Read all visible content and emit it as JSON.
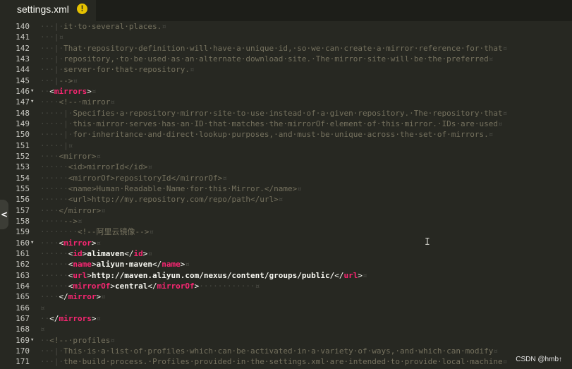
{
  "tab": {
    "title": "settings.xml",
    "badge": "!"
  },
  "watermark": "CSDN @hmb↑",
  "lines": [
    {
      "n": "140",
      "fold": "",
      "segs": [
        [
          "ws",
          "···|·"
        ],
        [
          "comment",
          "it·to·several·places."
        ],
        [
          "ws",
          "¤"
        ]
      ]
    },
    {
      "n": "141",
      "fold": "",
      "segs": [
        [
          "ws",
          "···|¤"
        ]
      ]
    },
    {
      "n": "142",
      "fold": "",
      "segs": [
        [
          "ws",
          "···|·"
        ],
        [
          "comment",
          "That·repository·definition·will·have·a·unique·id,·so·we·can·create·a·mirror·reference·for·that"
        ],
        [
          "ws",
          "¤"
        ]
      ]
    },
    {
      "n": "143",
      "fold": "",
      "segs": [
        [
          "ws",
          "···|·"
        ],
        [
          "comment",
          "repository,·to·be·used·as·an·alternate·download·site.·The·mirror·site·will·be·the·preferred"
        ],
        [
          "ws",
          "¤"
        ]
      ]
    },
    {
      "n": "144",
      "fold": "",
      "segs": [
        [
          "ws",
          "···|·"
        ],
        [
          "comment",
          "server·for·that·repository."
        ],
        [
          "ws",
          "¤"
        ]
      ]
    },
    {
      "n": "145",
      "fold": "",
      "segs": [
        [
          "ws",
          "···|"
        ],
        [
          "comment",
          "-->"
        ],
        [
          "ws",
          "¤"
        ]
      ]
    },
    {
      "n": "146",
      "fold": "▾",
      "segs": [
        [
          "ws",
          "··"
        ],
        [
          "text",
          "<"
        ],
        [
          "tagb",
          "mirrors"
        ],
        [
          "text",
          ">"
        ],
        [
          "ws",
          "¤"
        ]
      ]
    },
    {
      "n": "147",
      "fold": "▾",
      "segs": [
        [
          "ws",
          "····"
        ],
        [
          "comment",
          "<!--·mirror"
        ],
        [
          "ws",
          "¤"
        ]
      ]
    },
    {
      "n": "148",
      "fold": "",
      "segs": [
        [
          "ws",
          "·····|·"
        ],
        [
          "comment",
          "Specifies·a·repository·mirror·site·to·use·instead·of·a·given·repository.·The·repository·that"
        ],
        [
          "ws",
          "¤"
        ]
      ]
    },
    {
      "n": "149",
      "fold": "",
      "segs": [
        [
          "ws",
          "·····|·"
        ],
        [
          "comment",
          "this·mirror·serves·has·an·ID·that·matches·the·mirrorOf·element·of·this·mirror.·IDs·are·used"
        ],
        [
          "ws",
          "¤"
        ]
      ]
    },
    {
      "n": "150",
      "fold": "",
      "segs": [
        [
          "ws",
          "·····|·"
        ],
        [
          "comment",
          "for·inheritance·and·direct·lookup·purposes,·and·must·be·unique·across·the·set·of·mirrors."
        ],
        [
          "ws",
          "¤"
        ]
      ]
    },
    {
      "n": "151",
      "fold": "",
      "segs": [
        [
          "ws",
          "·····|¤"
        ]
      ]
    },
    {
      "n": "152",
      "fold": "",
      "segs": [
        [
          "ws",
          "····"
        ],
        [
          "comment",
          "<mirror>"
        ],
        [
          "ws",
          "¤"
        ]
      ]
    },
    {
      "n": "153",
      "fold": "",
      "segs": [
        [
          "ws",
          "······"
        ],
        [
          "comment",
          "<id>mirrorId</id>"
        ],
        [
          "ws",
          "¤"
        ]
      ]
    },
    {
      "n": "154",
      "fold": "",
      "segs": [
        [
          "ws",
          "······"
        ],
        [
          "comment",
          "<mirrorOf>repositoryId</mirrorOf>"
        ],
        [
          "ws",
          "¤"
        ]
      ]
    },
    {
      "n": "155",
      "fold": "",
      "segs": [
        [
          "ws",
          "······"
        ],
        [
          "comment",
          "<name>Human·Readable·Name·for·this·Mirror.</name>"
        ],
        [
          "ws",
          "¤"
        ]
      ]
    },
    {
      "n": "156",
      "fold": "",
      "segs": [
        [
          "ws",
          "······"
        ],
        [
          "comment",
          "<url>http://my.repository.com/repo/path</url>"
        ],
        [
          "ws",
          "¤"
        ]
      ]
    },
    {
      "n": "157",
      "fold": "",
      "segs": [
        [
          "ws",
          "····"
        ],
        [
          "comment",
          "</mirror>"
        ],
        [
          "ws",
          "¤"
        ]
      ]
    },
    {
      "n": "158",
      "fold": "",
      "segs": [
        [
          "ws",
          "·····"
        ],
        [
          "comment",
          "-->"
        ],
        [
          "ws",
          "¤"
        ]
      ]
    },
    {
      "n": "159",
      "fold": "",
      "segs": [
        [
          "ws",
          "········"
        ],
        [
          "comment",
          "<!--阿里云镜像-->"
        ],
        [
          "ws",
          "¤"
        ]
      ]
    },
    {
      "n": "160",
      "fold": "▾",
      "segs": [
        [
          "ws",
          "····"
        ],
        [
          "text",
          "<"
        ],
        [
          "tagb",
          "mirror"
        ],
        [
          "text",
          ">"
        ],
        [
          "ws",
          "¤"
        ]
      ]
    },
    {
      "n": "161",
      "fold": "",
      "segs": [
        [
          "ws",
          "······"
        ],
        [
          "text",
          "<"
        ],
        [
          "tagb",
          "id"
        ],
        [
          "text",
          ">"
        ],
        [
          "textb",
          "alimaven"
        ],
        [
          "text",
          "</"
        ],
        [
          "tagb",
          "id"
        ],
        [
          "text",
          ">"
        ],
        [
          "ws",
          "¤"
        ]
      ]
    },
    {
      "n": "162",
      "fold": "",
      "segs": [
        [
          "ws",
          "······"
        ],
        [
          "text",
          "<"
        ],
        [
          "tagb",
          "name"
        ],
        [
          "text",
          ">"
        ],
        [
          "textb",
          "aliyun·maven"
        ],
        [
          "text",
          "</"
        ],
        [
          "tagb",
          "name"
        ],
        [
          "text",
          ">"
        ],
        [
          "ws",
          "¤"
        ]
      ]
    },
    {
      "n": "163",
      "fold": "",
      "segs": [
        [
          "ws",
          "······"
        ],
        [
          "text",
          "<"
        ],
        [
          "tagb",
          "url"
        ],
        [
          "text",
          ">"
        ],
        [
          "textb",
          "http://maven.aliyun.com/nexus/content/groups/public/"
        ],
        [
          "text",
          "</"
        ],
        [
          "tagb",
          "url"
        ],
        [
          "text",
          ">"
        ],
        [
          "ws",
          "¤"
        ]
      ]
    },
    {
      "n": "164",
      "fold": "",
      "segs": [
        [
          "ws",
          "······"
        ],
        [
          "text",
          "<"
        ],
        [
          "tagb",
          "mirrorOf"
        ],
        [
          "text",
          ">"
        ],
        [
          "textb",
          "central"
        ],
        [
          "text",
          "</"
        ],
        [
          "tagb",
          "mirrorOf"
        ],
        [
          "text",
          ">"
        ],
        [
          "ws",
          "············¤"
        ]
      ]
    },
    {
      "n": "165",
      "fold": "",
      "segs": [
        [
          "ws",
          "····"
        ],
        [
          "text",
          "</"
        ],
        [
          "tagb",
          "mirror"
        ],
        [
          "text",
          ">"
        ],
        [
          "ws",
          "¤"
        ]
      ]
    },
    {
      "n": "166",
      "fold": "",
      "segs": [
        [
          "ws",
          "¤"
        ]
      ]
    },
    {
      "n": "167",
      "fold": "",
      "segs": [
        [
          "ws",
          "··"
        ],
        [
          "text",
          "</"
        ],
        [
          "tagb",
          "mirrors"
        ],
        [
          "text",
          ">"
        ],
        [
          "ws",
          "¤"
        ]
      ]
    },
    {
      "n": "168",
      "fold": "",
      "segs": [
        [
          "ws",
          "¤"
        ]
      ]
    },
    {
      "n": "169",
      "fold": "▾",
      "segs": [
        [
          "ws",
          "··"
        ],
        [
          "comment",
          "<!--·profiles"
        ],
        [
          "ws",
          "¤"
        ]
      ]
    },
    {
      "n": "170",
      "fold": "",
      "segs": [
        [
          "ws",
          "···|·"
        ],
        [
          "comment",
          "This·is·a·list·of·profiles·which·can·be·activated·in·a·variety·of·ways,·and·which·can·modify"
        ],
        [
          "ws",
          "¤"
        ]
      ]
    },
    {
      "n": "171",
      "fold": "",
      "segs": [
        [
          "ws",
          "···|·"
        ],
        [
          "comment",
          "the·build·process.·Profiles·provided·in·the·settings.xml·are·intended·to·provide·local·machine"
        ],
        [
          "ws",
          "¤"
        ]
      ]
    }
  ]
}
